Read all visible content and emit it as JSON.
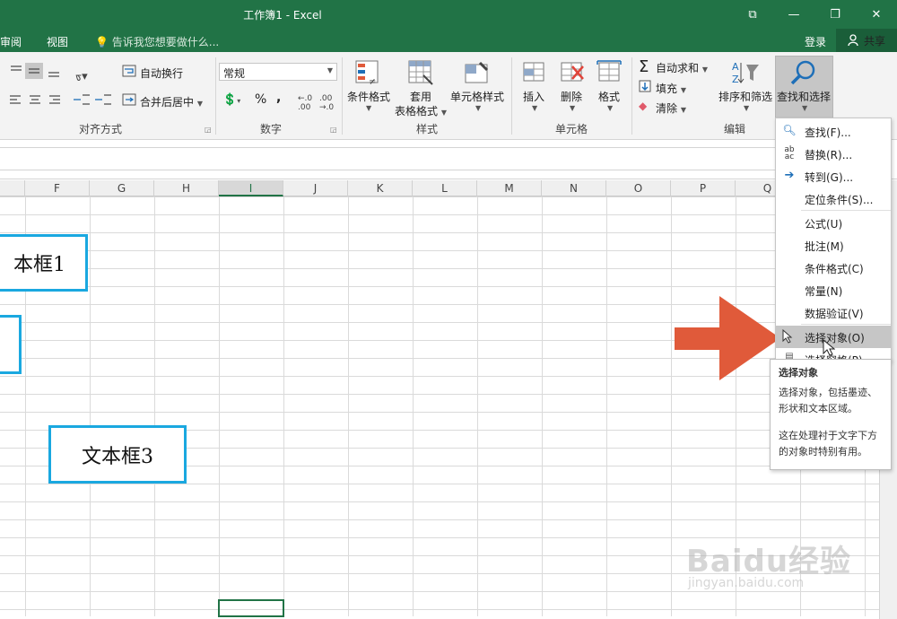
{
  "window": {
    "title": "工作簿1 - Excel",
    "controls": [
      "⧉",
      "—",
      "❐",
      "✕"
    ]
  },
  "tabs": {
    "review": "审阅",
    "view": "视图",
    "tell_me": "告诉我您想要做什么...",
    "login": "登录",
    "share": "共享"
  },
  "ribbon": {
    "alignment": {
      "wrap_text": "自动换行",
      "merge_center": "合并后居中",
      "label": "对齐方式"
    },
    "number": {
      "format_value": "常规",
      "percent": "%",
      "comma": ",",
      "label": "数字"
    },
    "styles": {
      "conditional": "条件格式",
      "format_table_1": "套用",
      "format_table_2": "表格格式",
      "cell_styles": "单元格样式",
      "label": "样式"
    },
    "cells": {
      "insert": "插入",
      "delete": "删除",
      "format": "格式",
      "label": "单元格"
    },
    "editing": {
      "autosum": "自动求和",
      "fill": "填充",
      "clear": "清除",
      "sort_filter": "排序和筛选",
      "find_select": "查找和选择",
      "label": "编辑"
    }
  },
  "columns": [
    "F",
    "G",
    "H",
    "I",
    "J",
    "K",
    "L",
    "M",
    "N",
    "O",
    "P",
    "Q"
  ],
  "selected_column": "I",
  "textboxes": {
    "box1": "本框1",
    "box3": "文本框3"
  },
  "dropdown": {
    "items": [
      {
        "label": "查找(F)...",
        "icon": "search-icon"
      },
      {
        "label": "替换(R)...",
        "icon": "replace-icon"
      },
      {
        "label": "转到(G)...",
        "icon": "arrow-right-icon"
      },
      {
        "label": "定位条件(S)...",
        "icon": ""
      },
      {
        "label": "公式(U)",
        "icon": ""
      },
      {
        "label": "批注(M)",
        "icon": ""
      },
      {
        "label": "条件格式(C)",
        "icon": ""
      },
      {
        "label": "常量(N)",
        "icon": ""
      },
      {
        "label": "数据验证(V)",
        "icon": ""
      },
      {
        "label": "选择对象(O)",
        "icon": "cursor-icon"
      },
      {
        "label": "选择窗格(P)...",
        "icon": "pane-icon"
      }
    ],
    "active_index": 9
  },
  "tooltip": {
    "title": "选择对象",
    "body": "选择对象，包括墨迹、\n形状和文本区域。",
    "note": "这在处理衬于文字下方\n的对象时特别有用。"
  },
  "watermark": {
    "brand": "Baidu经验",
    "url": "jingyan.baidu.com"
  },
  "colors": {
    "excel_green": "#217346",
    "textbox_border": "#1aa8e0",
    "arrow": "#e05a3a"
  }
}
